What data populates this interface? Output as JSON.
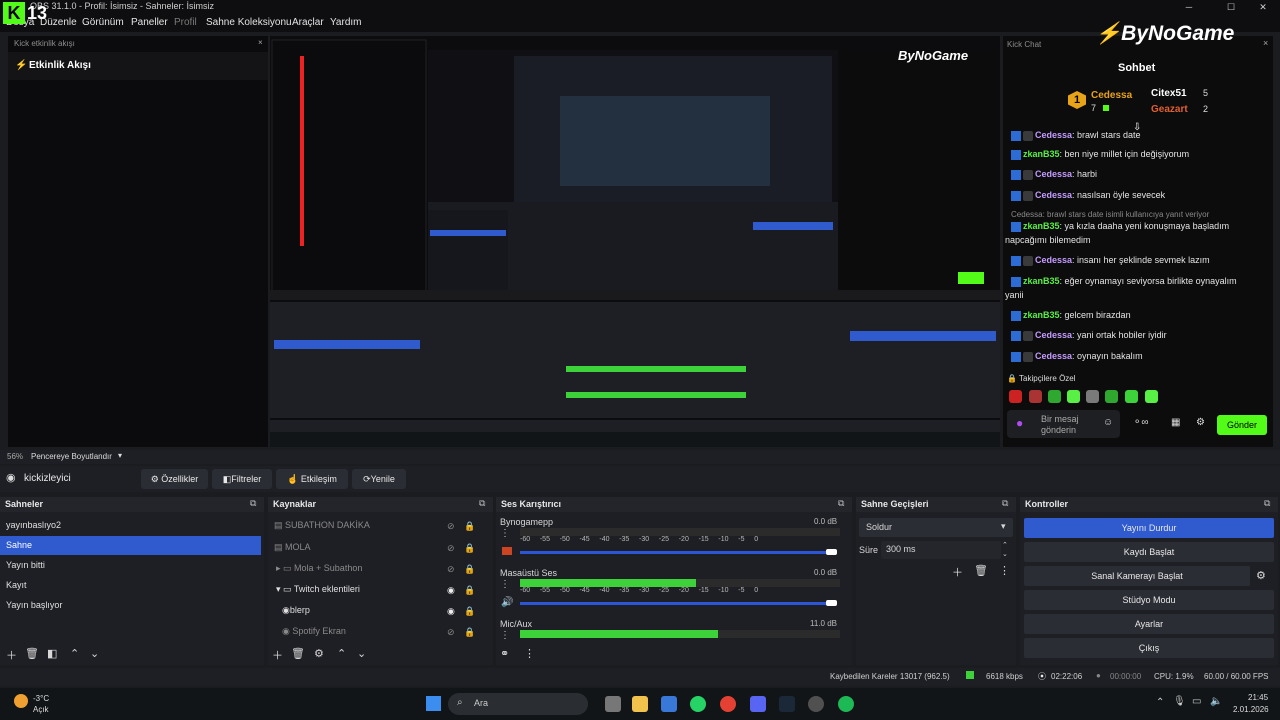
{
  "window": {
    "title": "OBS 31.1.0 - Profil: İsimsiz - Sahneler: İsimsiz",
    "kick_count": "13"
  },
  "menu": [
    "Dosya",
    "Düzenle",
    "Görünüm",
    "Paneller",
    "Profil",
    "Sahne Koleksiyonu",
    "Araçlar",
    "Yardım"
  ],
  "left_dock": {
    "title": "Kick etkinlik akışı",
    "header": "Etkinlik Akışı"
  },
  "brand": "ByNoGame",
  "chat": {
    "title": "Kick Chat",
    "heading": "Sohbet",
    "leaders": [
      {
        "name": "Cedessa",
        "count": "7"
      },
      {
        "name": "Citex51",
        "count": "5"
      },
      {
        "name": "Geazart",
        "count": "2"
      }
    ],
    "messages": [
      {
        "user": "Cedessa",
        "text": ": brawl stars date",
        "color": "#c59cff"
      },
      {
        "user": "zkanB35",
        "text": ": ben niye millet için değişiyorum",
        "color": "#58f044"
      },
      {
        "user": "Cedessa",
        "text": ": harbi",
        "color": "#c59cff"
      },
      {
        "user": "Cedessa",
        "text": ": nasılsan öyle sevecek",
        "color": "#c59cff"
      },
      {
        "user": "zkanB35",
        "text": ": ya kızla daaha yeni konuşmaya başladım",
        "color": "#58f044"
      },
      {
        "user": "Cedessa",
        "text": ": insanı her şeklinde sevmek lazım",
        "color": "#c59cff"
      },
      {
        "user": "zkanB35",
        "text": ": eğer oynamayı seviyorsa birlikte oynayalım",
        "color": "#58f044"
      },
      {
        "user": "zkanB35",
        "text": ": gelcem birazdan",
        "color": "#58f044"
      },
      {
        "user": "Cedessa",
        "text": ": yani ortak hobiler iyidir",
        "color": "#c59cff"
      },
      {
        "user": "Cedessa",
        "text": ": oynayın bakalım",
        "color": "#c59cff"
      }
    ],
    "reply_note": "Cedessa: brawl stars date isimli kullanıcıya yanıt veriyor",
    "cont_5": "napcağımı bilemedim",
    "cont_7": "yanii",
    "special": "Takipçilere Özel",
    "placeholder_1": "Bir mesaj",
    "placeholder_2": "gönderin",
    "send": "Gönder"
  },
  "scale": {
    "percent": "56%",
    "fit": "Pencereye Boyutlandır"
  },
  "source_bar": {
    "name": "kickizleyici",
    "props": "Özellikler",
    "filters": "Filtreler",
    "interact": "Etkileşim",
    "refresh": "Yenile"
  },
  "scenes": {
    "title": "Sahneler",
    "items": [
      "yayınbaslıyo2",
      "Sahne",
      "Yayın bitti",
      "Kayıt",
      "Yayın başlıyor"
    ]
  },
  "sources": {
    "title": "Kaynaklar",
    "items": [
      "SUBATHON DAKİKA",
      "MOLA",
      "Mola + Subathon",
      "Twitch eklentileri",
      "blerp",
      "Spotify Ekran"
    ]
  },
  "mixer": {
    "title": "Ses Karıştırıcı",
    "channels": [
      {
        "name": "Bynogamepp",
        "db": "0.0 dB",
        "level": 0
      },
      {
        "name": "Masaüstü Ses",
        "db": "0.0 dB",
        "level": 0.55
      },
      {
        "name": "Mic/Aux",
        "db": "11.0 dB",
        "level": 0.62
      }
    ],
    "scale": [
      "-60",
      "-55",
      "-50",
      "-45",
      "-40",
      "-35",
      "-30",
      "-25",
      "-20",
      "-15",
      "-10",
      "-5",
      "0"
    ]
  },
  "transitions": {
    "title": "Sahne Geçişleri",
    "value": "Soldur",
    "duration_label": "Süre",
    "duration": "300 ms"
  },
  "controls": {
    "title": "Kontroller",
    "buttons": [
      "Yayını Durdur",
      "Kaydı Başlat",
      "Sanal Kamerayı Başlat",
      "Stüdyo Modu",
      "Ayarlar",
      "Çıkış"
    ]
  },
  "status": {
    "dropped": "Kaybedilen Kareler 13017 (962.5)",
    "kbps": "6618 kbps",
    "live": "02:22:06",
    "rec": "00:00:00",
    "cpu": "CPU: 1.9%",
    "fps": "60.00 / 60.00 FPS"
  },
  "taskbar": {
    "temp": "-3°C",
    "weather": "Açık",
    "search": "Ara",
    "time": "21:45",
    "date": "2.01.2026"
  },
  "colors": {
    "accent": "#2f5bcf",
    "kick_green": "#53fc18",
    "meter_green": "#3ed23a"
  }
}
